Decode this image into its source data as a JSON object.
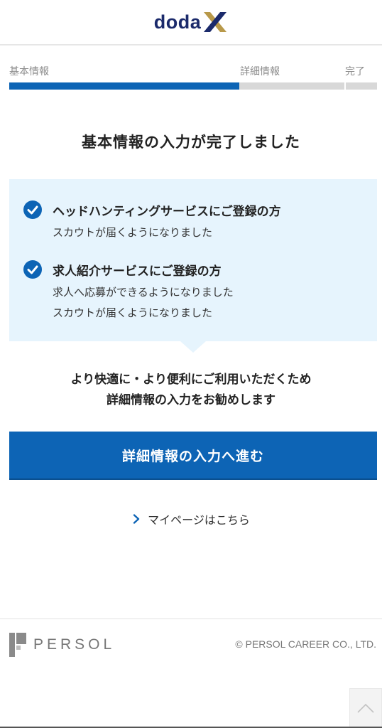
{
  "header": {
    "logo_text": "doda"
  },
  "steps": {
    "items": [
      "基本情報",
      "詳細情報",
      "完了"
    ],
    "progress_fraction": 0.625
  },
  "title": "基本情報の入力が完了しました",
  "info": {
    "items": [
      {
        "heading": "ヘッドハンティングサービスにご登録の方",
        "lines": [
          "スカウトが届くようになりました"
        ]
      },
      {
        "heading": "求人紹介サービスにご登録の方",
        "lines": [
          "求人へ応募ができるようになりました",
          "スカウトが届くようになりました"
        ]
      }
    ]
  },
  "recommend": {
    "line1": "より快適に・より便利にご利用いただくため",
    "line2": "詳細情報の入力をお勧めします"
  },
  "cta_label": "詳細情報の入力へ進む",
  "mypage_link": "マイページはこちら",
  "footer": {
    "brand": "PERSOL",
    "copyright": "© PERSOL CAREER CO., LTD."
  },
  "colors": {
    "brand_blue": "#0d64b5",
    "logo_navy": "#1b2a6b",
    "logo_gold": "#b8994a",
    "info_bg": "#e6f4fd"
  },
  "icons": [
    "check-circle-icon",
    "chevron-right-icon",
    "chevron-up-icon",
    "persol-logo-icon",
    "doda-x-logo-icon"
  ]
}
